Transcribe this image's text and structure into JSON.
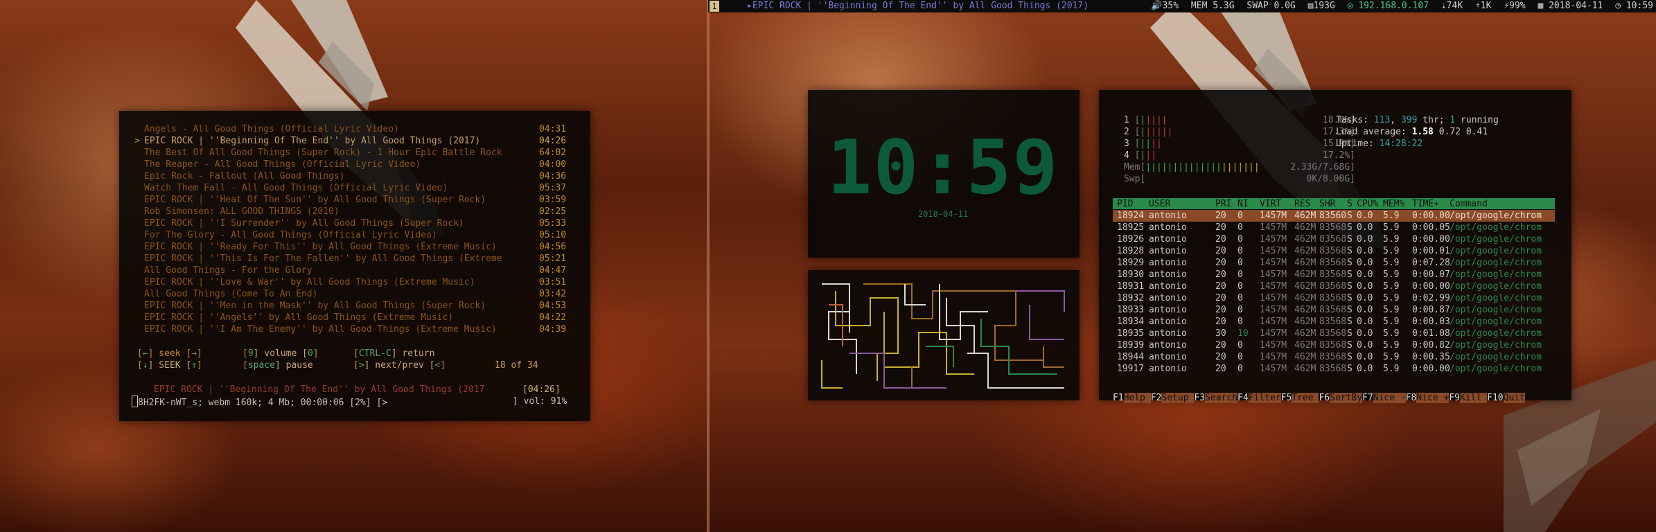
{
  "topbar": {
    "workspace": "1",
    "now_playing": "▸EPIC ROCK | ''Beginning Of The End'' by All Good Things (2017)",
    "volume": "🔊35%",
    "mem": "MEM 5.3G",
    "swap": "SWAP 0.0G",
    "disk": "▤193G",
    "ip": "◎ 192.168.0.107",
    "net_down": "⇣74K",
    "net_up": "⇡1K",
    "battery": "⚡99%",
    "date": "▦ 2018-04-11",
    "time": "◷ 10:59"
  },
  "player": {
    "marker": ">",
    "playlist": [
      {
        "title": "Angels - All Good Things (Official Lyric Video)",
        "duration": "04:31"
      },
      {
        "title": "EPIC ROCK | ''Beginning Of The End'' by All Good Things (2017)",
        "duration": "04:26"
      },
      {
        "title": "The Best Of All Good Things (Super Rock) - 1 Hour Epic Battle Rock",
        "duration": "64:02"
      },
      {
        "title": "The Reaper - All Good Things (Official Lyric Video)",
        "duration": "04:00"
      },
      {
        "title": "Epic Rock - Fallout (All Good Things)",
        "duration": "04:36"
      },
      {
        "title": "Watch Them Fall - All Good Things (Official Lyric Video)",
        "duration": "05:37"
      },
      {
        "title": "EPIC ROCK | ''Heat Of The Sun'' by All Good Things (Super Rock)",
        "duration": "03:59"
      },
      {
        "title": "Rob Simonsen: ALL GOOD THINGS (2010)",
        "duration": "02:25"
      },
      {
        "title": "EPIC ROCK | ''I Surrender'' by All Good Things (Super Rock)",
        "duration": "05:33"
      },
      {
        "title": "For The Glory - All Good Things (Official Lyric Video)",
        "duration": "05:10"
      },
      {
        "title": "EPIC ROCK | ''Ready For This'' by All Good Things (Extreme Music)",
        "duration": "04:56"
      },
      {
        "title": "EPIC ROCK | ''This Is For The Fallen'' by All Good Things (Extreme",
        "duration": "05:21"
      },
      {
        "title": "All Good Things - For the Glory",
        "duration": "04:47"
      },
      {
        "title": "EPIC ROCK | ''Love & War'' by All Good Things (Extreme Music)",
        "duration": "03:51"
      },
      {
        "title": "All Good Things (Come To An End)",
        "duration": "03:42"
      },
      {
        "title": "EPIC ROCK | ''Men in the Mask'' by All Good Things (Super Rock)",
        "duration": "04:53"
      },
      {
        "title": "EPIC ROCK | ''Angels'' by All Good Things (Extreme Music)",
        "duration": "04:22"
      },
      {
        "title": "EPIC ROCK | ''I Am The Enemy'' by All Good Things (Extreme Music)",
        "duration": "04:39"
      }
    ],
    "keys": {
      "k1a": "[",
      "k1b": "←",
      "k1c": "] seek [",
      "k1d": "→",
      "k1e": "]",
      "k2a": "[",
      "k2b": "9",
      "k2c": "] volume [",
      "k2d": "0",
      "k2e": "]",
      "k3a": "[",
      "k3b": "CTRL-C",
      "k3c": "] return",
      "k4a": "[",
      "k4b": "↓",
      "k4c": "] SEEK [",
      "k4d": "↑",
      "k4e": "]",
      "k5a": "[",
      "k5b": "space",
      "k5c": "] pause",
      "k6a": "[",
      "k6b": ">",
      "k6c": "] next/prev [",
      "k6d": "<",
      "k6e": "]",
      "position": "18 of 34"
    },
    "now_playing": "EPIC ROCK | ''Beginning Of The End'' by All Good Things (2017",
    "now_playing_duration": "[04:26]",
    "status": "8H2FK-nWT_s; webm 160k; 4 Mb; 00:00:06 [2%]   [>",
    "volume": "] vol: 91%"
  },
  "clock": {
    "time": "10:59",
    "date": "2018-04-11"
  },
  "htop": {
    "cpus": [
      {
        "n": "1",
        "green": "|",
        "red": "||||",
        "pct": "18.0%]"
      },
      {
        "n": "2",
        "green": "|",
        "red": "|||||",
        "pct": "17.3%]"
      },
      {
        "n": "3",
        "green": "||",
        "red": "||",
        "pct": "15.9%]"
      },
      {
        "n": "4",
        "green": "|",
        "red": "||",
        "pct": "17.2%]"
      }
    ],
    "mem_label": "Mem[",
    "mem_bar": "||||||||||||||",
    "mem_bar_y": "|||||||",
    "mem_val": "2.33G/7.68G]",
    "swp_label": "Swp[",
    "swp_val": "0K/8.00G]",
    "tasks_label": "Tasks: ",
    "tasks": "113",
    "thr": "399",
    "running": "1",
    "tasks_mid1": ", ",
    "tasks_mid2": " thr; ",
    "tasks_end": " running",
    "load_label": "Load average: ",
    "load1": "1.58",
    "load_rest": " 0.72 0.41",
    "uptime_label": "Uptime: ",
    "uptime": "14:28:22",
    "columns": [
      "PID",
      "USER",
      "PRI",
      "NI",
      "VIRT",
      "RES",
      "SHR",
      "S",
      "CPU%",
      "MEM%",
      "TIME+",
      "Command"
    ],
    "processes": [
      {
        "pid": "18924",
        "user": "antonio",
        "pri": "20",
        "ni": "0",
        "virt": "1457M",
        "res": "462M",
        "shr": "83560",
        "s": "S",
        "cpu": "0.0",
        "mem": "5.9",
        "time": "0:00.00",
        "cmd": "/opt/google/chrom"
      },
      {
        "pid": "18925",
        "user": "antonio",
        "pri": "20",
        "ni": "0",
        "virt": "1457M",
        "res": "462M",
        "shr": "83568",
        "s": "S",
        "cpu": "0.0",
        "mem": "5.9",
        "time": "0:00.05",
        "cmd": "/opt/google/chrom"
      },
      {
        "pid": "18926",
        "user": "antonio",
        "pri": "20",
        "ni": "0",
        "virt": "1457M",
        "res": "462M",
        "shr": "83568",
        "s": "S",
        "cpu": "0.0",
        "mem": "5.9",
        "time": "0:00.00",
        "cmd": "/opt/google/chrom"
      },
      {
        "pid": "18928",
        "user": "antonio",
        "pri": "20",
        "ni": "0",
        "virt": "1457M",
        "res": "462M",
        "shr": "83568",
        "s": "S",
        "cpu": "0.0",
        "mem": "5.9",
        "time": "0:00.01",
        "cmd": "/opt/google/chrom"
      },
      {
        "pid": "18929",
        "user": "antonio",
        "pri": "20",
        "ni": "0",
        "virt": "1457M",
        "res": "462M",
        "shr": "83568",
        "s": "S",
        "cpu": "0.0",
        "mem": "5.9",
        "time": "0:07.28",
        "cmd": "/opt/google/chrom"
      },
      {
        "pid": "18930",
        "user": "antonio",
        "pri": "20",
        "ni": "0",
        "virt": "1457M",
        "res": "462M",
        "shr": "83568",
        "s": "S",
        "cpu": "0.0",
        "mem": "5.9",
        "time": "0:00.07",
        "cmd": "/opt/google/chrom"
      },
      {
        "pid": "18931",
        "user": "antonio",
        "pri": "20",
        "ni": "0",
        "virt": "1457M",
        "res": "462M",
        "shr": "83568",
        "s": "S",
        "cpu": "0.0",
        "mem": "5.9",
        "time": "0:00.00",
        "cmd": "/opt/google/chrom"
      },
      {
        "pid": "18932",
        "user": "antonio",
        "pri": "20",
        "ni": "0",
        "virt": "1457M",
        "res": "462M",
        "shr": "83568",
        "s": "S",
        "cpu": "0.0",
        "mem": "5.9",
        "time": "0:02.99",
        "cmd": "/opt/google/chrom"
      },
      {
        "pid": "18933",
        "user": "antonio",
        "pri": "20",
        "ni": "0",
        "virt": "1457M",
        "res": "462M",
        "shr": "83568",
        "s": "S",
        "cpu": "0.0",
        "mem": "5.9",
        "time": "0:00.87",
        "cmd": "/opt/google/chrom"
      },
      {
        "pid": "18934",
        "user": "antonio",
        "pri": "20",
        "ni": "0",
        "virt": "1457M",
        "res": "462M",
        "shr": "83568",
        "s": "S",
        "cpu": "0.0",
        "mem": "5.9",
        "time": "0:00.03",
        "cmd": "/opt/google/chrom"
      },
      {
        "pid": "18935",
        "user": "antonio",
        "pri": "30",
        "ni": "10",
        "virt": "1457M",
        "res": "462M",
        "shr": "83568",
        "s": "S",
        "cpu": "0.0",
        "mem": "5.9",
        "time": "0:01.08",
        "cmd": "/opt/google/chrom"
      },
      {
        "pid": "18939",
        "user": "antonio",
        "pri": "20",
        "ni": "0",
        "virt": "1457M",
        "res": "462M",
        "shr": "83568",
        "s": "S",
        "cpu": "0.0",
        "mem": "5.9",
        "time": "0:00.82",
        "cmd": "/opt/google/chrom"
      },
      {
        "pid": "18944",
        "user": "antonio",
        "pri": "20",
        "ni": "0",
        "virt": "1457M",
        "res": "462M",
        "shr": "83568",
        "s": "S",
        "cpu": "0.0",
        "mem": "5.9",
        "time": "0:00.35",
        "cmd": "/opt/google/chrom"
      },
      {
        "pid": "19917",
        "user": "antonio",
        "pri": "20",
        "ni": "0",
        "virt": "1457M",
        "res": "462M",
        "shr": "83568",
        "s": "S",
        "cpu": "0.0",
        "mem": "5.9",
        "time": "0:00.00",
        "cmd": "/opt/google/chrom"
      }
    ],
    "fkeys": [
      {
        "k": "F1",
        "l": "Help  "
      },
      {
        "k": "F2",
        "l": "Setup "
      },
      {
        "k": "F3",
        "l": "Search"
      },
      {
        "k": "F4",
        "l": "Filter"
      },
      {
        "k": "F5",
        "l": "Tree  "
      },
      {
        "k": "F6",
        "l": "SortBy"
      },
      {
        "k": "F7",
        "l": "Nice -"
      },
      {
        "k": "F8",
        "l": "Nice +"
      },
      {
        "k": "F9",
        "l": "Kill  "
      },
      {
        "k": "F10",
        "l": "Quit"
      }
    ]
  },
  "colors": {
    "clock_green": "#0d5a3a",
    "htop_header": "#2a8a4a",
    "htop_selected": "#8a4a28",
    "playlist_text": "#8a5418",
    "topbar_accent": "#7a7adc"
  }
}
